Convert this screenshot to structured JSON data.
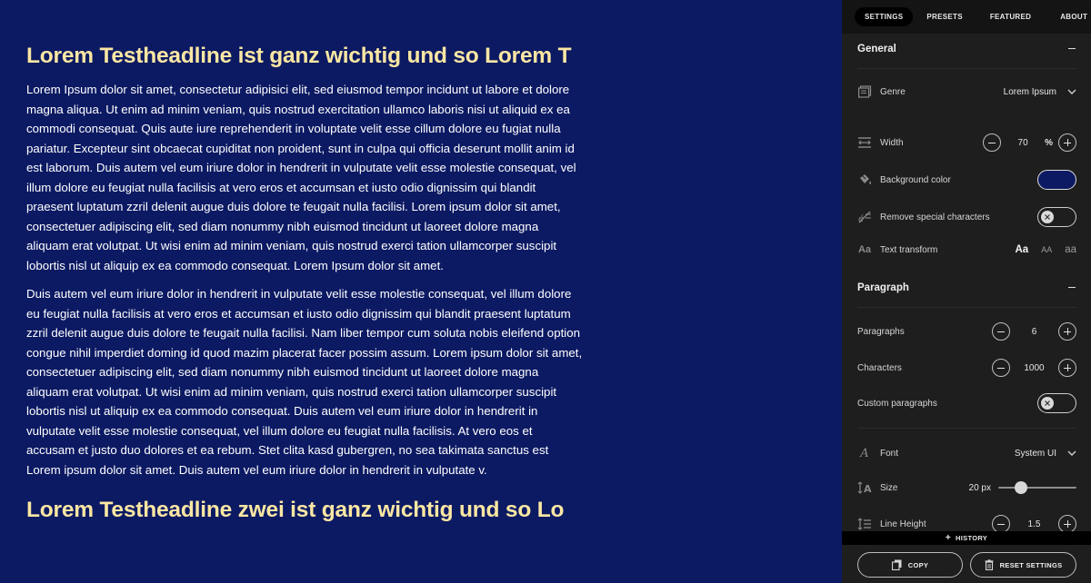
{
  "preview": {
    "background_color": "#0c1a63",
    "headline_color": "#fbe7a3",
    "headline_1": "Lorem Testheadline ist ganz wichtig und so Lorem T",
    "paragraph_1": "Lorem Ipsum dolor sit amet, consectetur adipisici elit, sed eiusmod tempor incidunt ut labore et dolore magna aliqua. Ut enim ad minim veniam, quis nostrud exercitation ullamco laboris nisi ut aliquid ex ea commodi consequat. Quis aute iure reprehenderit in voluptate velit esse cillum dolore eu fugiat nulla pariatur. Excepteur sint obcaecat cupiditat non proident, sunt in culpa qui officia deserunt mollit anim id est laborum. Duis autem vel eum iriure dolor in hendrerit in vulputate velit esse molestie consequat, vel illum dolore eu feugiat nulla facilisis at vero eros et accumsan et iusto odio dignissim qui blandit praesent luptatum zzril delenit augue duis dolore te feugait nulla facilisi. Lorem ipsum dolor sit amet, consectetuer adipiscing elit, sed diam nonummy nibh euismod tincidunt ut laoreet dolore magna aliquam erat volutpat. Ut wisi enim ad minim veniam, quis nostrud exerci tation ullamcorper suscipit lobortis nisl ut aliquip ex ea commodo consequat. Lorem Ipsum dolor sit amet.",
    "paragraph_2": "Duis autem vel eum iriure dolor in hendrerit in vulputate velit esse molestie consequat, vel illum dolore eu feugiat nulla facilisis at vero eros et accumsan et iusto odio dignissim qui blandit praesent luptatum zzril delenit augue duis dolore te feugait nulla facilisi. Nam liber tempor cum soluta nobis eleifend option congue nihil imperdiet doming id quod mazim placerat facer possim assum. Lorem ipsum dolor sit amet, consectetuer adipiscing elit, sed diam nonummy nibh euismod tincidunt ut laoreet dolore magna aliquam erat volutpat. Ut wisi enim ad minim veniam, quis nostrud exerci tation ullamcorper suscipit lobortis nisl ut aliquip ex ea commodo consequat. Duis autem vel eum iriure dolor in hendrerit in vulputate velit esse molestie consequat, vel illum dolore eu feugiat nulla facilisis. At vero eos et accusam et justo duo dolores et ea rebum. Stet clita kasd gubergren, no sea takimata sanctus est Lorem ipsum dolor sit amet. Duis autem vel eum iriure dolor in hendrerit in vulputate v.",
    "headline_2": "Lorem Testheadline zwei ist ganz wichtig und so Lo"
  },
  "tabs": [
    {
      "label": "SETTINGS",
      "active": true
    },
    {
      "label": "PRESETS",
      "active": false
    },
    {
      "label": "FEATURED",
      "active": false
    },
    {
      "label": "ABOUT",
      "active": false
    }
  ],
  "general": {
    "title": "General",
    "genre": {
      "label": "Genre",
      "value": "Lorem Ipsum",
      "icon": "book-icon"
    },
    "width": {
      "label": "Width",
      "value": "70",
      "unit": "%",
      "icon": "width-icon"
    },
    "background": {
      "label": "Background color",
      "value": "#0c1a63",
      "icon": "paint-bucket-icon"
    },
    "remove_special": {
      "label": "Remove special characters",
      "enabled": false,
      "icon": "special-chars-icon"
    },
    "text_transform": {
      "label": "Text transform",
      "icon": "text-transform-icon",
      "options": [
        "Aa",
        "AA",
        "aa"
      ],
      "selected": "Aa"
    }
  },
  "paragraph": {
    "title": "Paragraph",
    "paragraphs": {
      "label": "Paragraphs",
      "value": "6"
    },
    "characters": {
      "label": "Characters",
      "value": "1000"
    },
    "custom": {
      "label": "Custom paragraphs",
      "enabled": false
    }
  },
  "font": {
    "font": {
      "label": "Font",
      "value": "System UI",
      "icon": "font-icon"
    },
    "size": {
      "label": "Size",
      "value": "20 px",
      "icon": "font-size-icon",
      "slider_fraction": 0.25
    },
    "line_height": {
      "label": "Line Height",
      "value": "1.5",
      "icon": "line-height-icon"
    }
  },
  "footer": {
    "history_label": "HISTORY",
    "copy_label": "COPY",
    "reset_label": "RESET SETTINGS"
  }
}
